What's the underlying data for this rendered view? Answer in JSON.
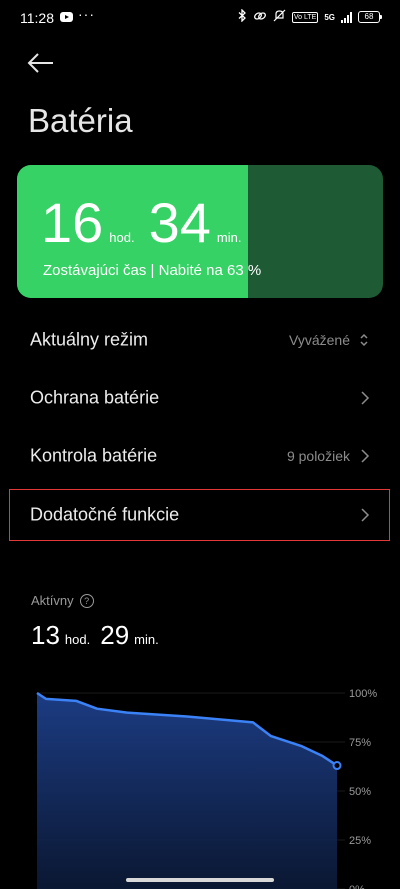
{
  "status": {
    "time": "11:28",
    "more": "···",
    "battery_level": "68",
    "network": "5G",
    "vo": "Vo LTE",
    "icons": [
      "youtube-icon",
      "bluetooth-icon",
      "link-icon",
      "mute-icon",
      "signal-icon",
      "battery-icon"
    ]
  },
  "page": {
    "title": "Batéria"
  },
  "battery_card": {
    "hours": "16",
    "hours_unit": "hod.",
    "minutes": "34",
    "minutes_unit": "min.",
    "subtitle": "Zostávajúci čas | Nabité na 63 %",
    "level_fraction": 0.63,
    "fill_color": "#37d265",
    "empty_color": "#1e5a34"
  },
  "settings": [
    {
      "label": "Aktuálny režim",
      "value": "Vyvážené",
      "control": "updown"
    },
    {
      "label": "Ochrana batérie",
      "value": "",
      "control": "chevron"
    },
    {
      "label": "Kontrola batérie",
      "value": "9 položiek",
      "control": "chevron"
    },
    {
      "label": "Dodatočné funkcie",
      "value": "",
      "control": "chevron",
      "highlighted": true
    }
  ],
  "active": {
    "label": "Aktívny",
    "hours": "13",
    "hours_unit": "hod.",
    "minutes": "29",
    "minutes_unit": "min."
  },
  "chart_data": {
    "type": "area",
    "y_tick_labels": [
      "100%",
      "75%",
      "50%",
      "25%",
      "0%"
    ],
    "ylim": [
      0,
      100
    ],
    "x": [
      0,
      0.03,
      0.13,
      0.2,
      0.3,
      0.5,
      0.72,
      0.78,
      0.88,
      0.95,
      1.0
    ],
    "values": [
      100,
      97,
      96,
      92,
      90,
      88,
      85,
      78,
      73,
      68,
      63
    ],
    "line_color": "#3b82f6"
  }
}
